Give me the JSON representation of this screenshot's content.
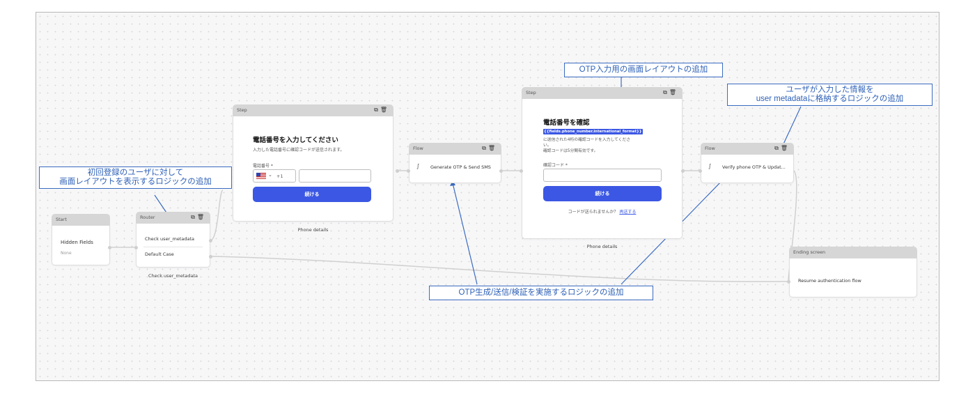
{
  "nodes": {
    "start": {
      "header": "Start",
      "title": "Hidden Fields",
      "sub": "None"
    },
    "router": {
      "header": "Router",
      "row1": "Check user_metadata",
      "row2": "Default Case",
      "caption": "Check user_metadata"
    },
    "step1": {
      "header": "Step",
      "heading": "電話番号を入力してください",
      "desc": "入力した電話番号に確認コードが送信されます。",
      "field_label": "電話番号 *",
      "dial_code": "+1",
      "button": "続ける",
      "caption": "Phone details"
    },
    "flow1": {
      "header": "Flow",
      "label": "Generate OTP & Send SMS"
    },
    "step2": {
      "header": "Step",
      "heading": "電話番号を確認",
      "token": "{{fields.phone_number.international_format}}",
      "desc1": "に送信された4桁の確認コードを入力してくださ",
      "desc2": "い。",
      "desc3": "確認コードは5分間有効です。",
      "field_label": "確認コード *",
      "button": "続ける",
      "resend_text": "コードが送られませんか？",
      "resend_link": "再送する",
      "caption": "Phone details"
    },
    "flow2": {
      "header": "Flow",
      "label": "Verify phone OTP & Updat..."
    },
    "ending": {
      "header": "Ending screen",
      "label": "Resume authentication flow"
    }
  },
  "callouts": {
    "router_note_line1": "初回登録のユーザに対して",
    "router_note_line2": "画面レイアウトを表示するロジックの追加",
    "otp_screen": "OTP入力用の画面レイアウトの追加",
    "metadata_line1": "ユーザが入力した情報を",
    "metadata_line2": "user metadataに格納するロジックの追加",
    "otp_logic": "OTP生成/送信/検証を実施するロジックの追加"
  },
  "icons": {
    "copy": "copy-icon",
    "trash": "trash-icon",
    "flow": "flow-icon",
    "flag": "us-flag-icon",
    "chevron": "chevron-down-icon"
  },
  "colors": {
    "accent": "#3b57e3",
    "callout_border": "#3a6bc0",
    "token_bg": "#3b57e3"
  }
}
